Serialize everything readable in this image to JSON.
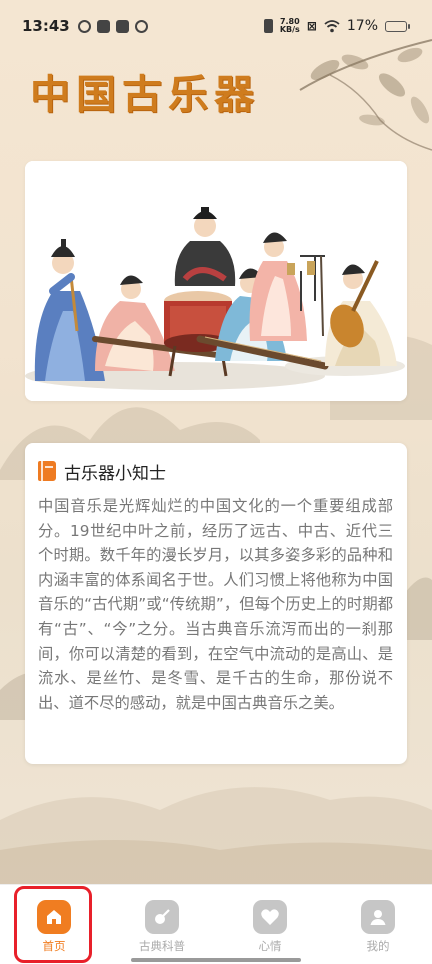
{
  "status_bar": {
    "time": "13:43",
    "net_speed_value": "7.80",
    "net_speed_unit": "KB/s",
    "battery": "17%"
  },
  "header": {
    "title": "中国古乐器"
  },
  "hero": {
    "image": "ancient-musicians-illustration"
  },
  "info_card": {
    "title": "古乐器小知士",
    "body": "中国音乐是光辉灿烂的中国文化的一个重要组成部分。19世纪中叶之前，经历了远古、中古、近代三个时期。数千年的漫长岁月，以其多姿多彩的品种和内涵丰富的体系闻名于世。人们习惯上将他称为中国音乐的“古代期”或“传统期”，但每个历史上的时期都有“古”、“今”之分。当古典音乐流泻而出的一刹那间，你可以清楚的看到，在空气中流动的是高山、是流水、是丝竹、是冬雪、是千古的生命，那份说不出、道不尽的感动，就是中国古典音乐之美。"
  },
  "tabbar": {
    "tabs": [
      {
        "label": "首页",
        "icon": "home-icon",
        "active": true
      },
      {
        "label": "古典科普",
        "icon": "music-icon",
        "active": false
      },
      {
        "label": "心情",
        "icon": "heart-icon",
        "active": false
      },
      {
        "label": "我的",
        "icon": "user-icon",
        "active": false
      }
    ]
  },
  "colors": {
    "accent": "#f07d21",
    "title": "#cf7c1e",
    "highlight": "#e8202a"
  }
}
